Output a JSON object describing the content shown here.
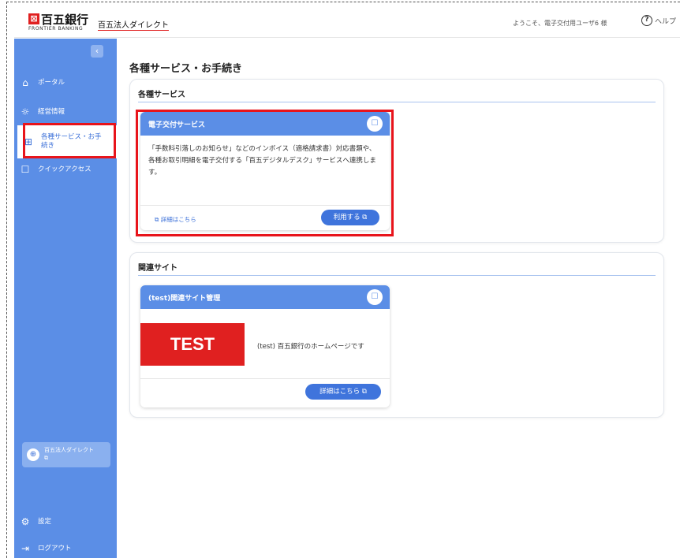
{
  "header": {
    "bank_mark": "⊠",
    "bank_name": "百五銀行",
    "bank_sub": "FRONTIER BANKING",
    "product_name": "百五法人ダイレクト",
    "welcome": "ようこそ、電子交付用ユーザ6 様",
    "help_icon": "?",
    "help_label": "ヘルプ"
  },
  "sidebar": {
    "collapse_glyph": "‹",
    "items": [
      {
        "icon": "⌂",
        "label": "ポータル"
      },
      {
        "icon": "☼",
        "label": "経営情報"
      },
      {
        "icon": "⊞",
        "label": "各種サービス・お手続き"
      },
      {
        "icon": "☐",
        "label": "クイックアクセス"
      }
    ],
    "site_link": {
      "label": "百五法人ダイレクト",
      "ext": "⧉"
    },
    "settings": {
      "icon": "⚙",
      "label": "設定"
    },
    "logout": {
      "icon": "⇥",
      "label": "ログアウト"
    }
  },
  "main": {
    "page_title": "各種サービス・お手続き",
    "services": {
      "title": "各種サービス",
      "card": {
        "title": "電子交付サービス",
        "description": "「手数料引落しのお知らせ」などのインボイス（適格請求書）対応書類や、各種お取引明細を電子交付する「百五デジタルデスク」サービスへ連携します。",
        "detail_link": "⧉ 詳細はこちら",
        "use_button": "利用する ⧉"
      }
    },
    "related": {
      "title": "関連サイト",
      "card": {
        "title": "(test)関連サイト管理",
        "image_text": "TEST",
        "caption": "(test) 百五銀行のホームページです",
        "detail_button": "詳細はこちら ⧉"
      }
    }
  },
  "colors": {
    "accent": "#5b8ee6",
    "button": "#3f74dc",
    "highlight": "#e8141b",
    "brand_red": "#e02020"
  }
}
